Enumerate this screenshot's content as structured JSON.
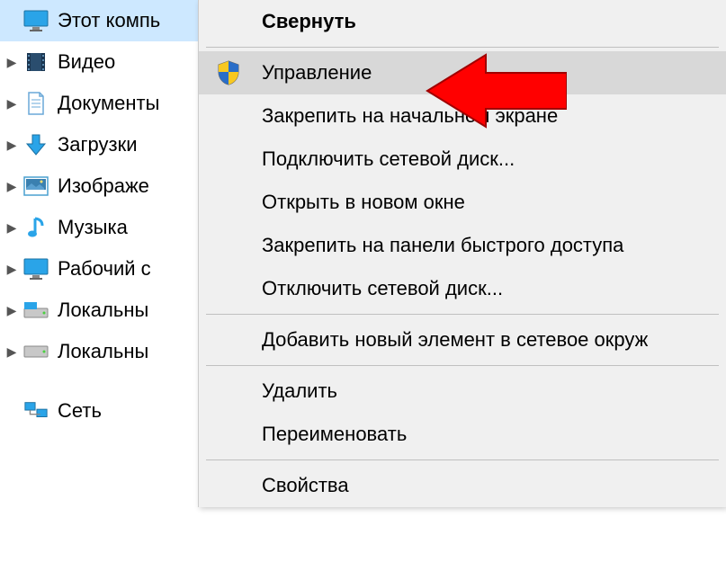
{
  "sidebar": {
    "this_pc": "Этот компь",
    "items": [
      {
        "label": "Видео"
      },
      {
        "label": "Документы"
      },
      {
        "label": "Загрузки"
      },
      {
        "label": "Изображе"
      },
      {
        "label": "Музыка"
      },
      {
        "label": "Рабочий с"
      },
      {
        "label": "Локальны"
      },
      {
        "label": "Локальны"
      }
    ],
    "network": "Сеть"
  },
  "menu": {
    "collapse": "Свернуть",
    "manage": "Управление",
    "pin_start": "Закрепить на начальном экране",
    "map_drive": "Подключить сетевой диск...",
    "open_new_window": "Открыть в новом окне",
    "pin_quick": "Закрепить на панели быстрого доступа",
    "disconnect_drive": "Отключить сетевой диск...",
    "add_network_location": "Добавить новый элемент в сетевое окруж",
    "delete": "Удалить",
    "rename": "Переименовать",
    "properties": "Свойства"
  }
}
